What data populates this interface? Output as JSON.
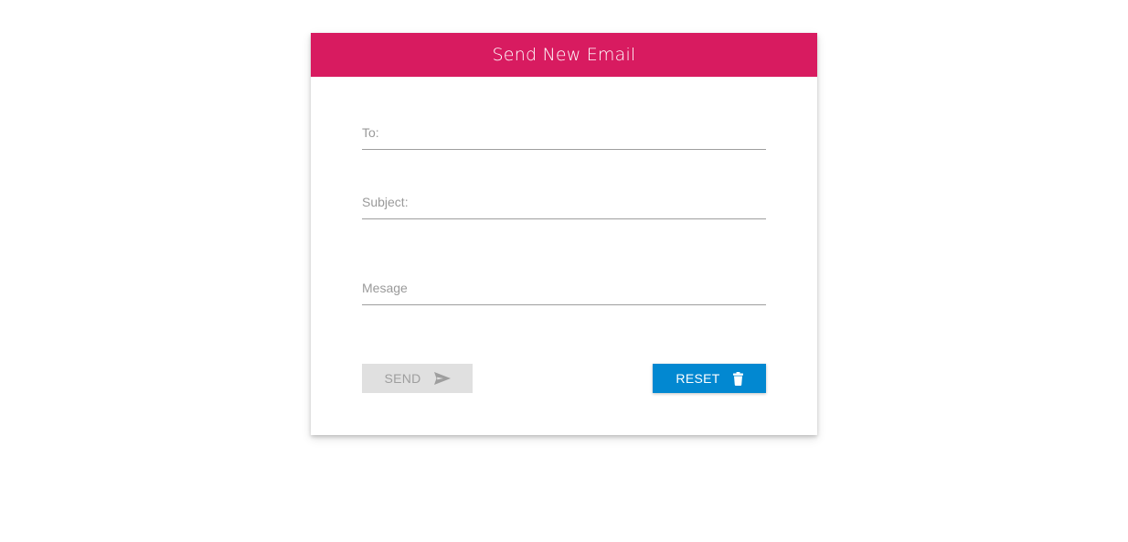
{
  "form": {
    "title": "Send New Email",
    "to_placeholder": "To:",
    "subject_placeholder": "Subject:",
    "message_placeholder": "Mesage"
  },
  "buttons": {
    "send_label": "SEND",
    "send_icon": "send-icon",
    "reset_label": "RESET",
    "reset_icon": "trash-icon"
  },
  "colors": {
    "header": "#d81b60",
    "reset_button": "#0288d1",
    "send_button_disabled": "#e0e0e0"
  }
}
